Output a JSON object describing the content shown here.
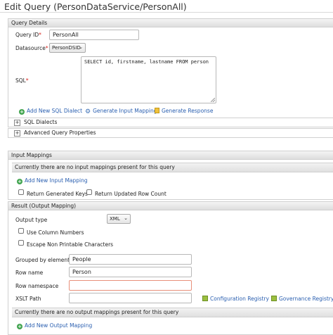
{
  "page": {
    "title": "Edit Query (PersonDataService/PersonAll)"
  },
  "query_details": {
    "header": "Query Details",
    "query_id_label": "Query ID",
    "required_mark": "*",
    "query_id_value": "PersonAll",
    "datasource_label": "Datasource",
    "datasource_value": "PersonDSID",
    "sql_label": "SQL",
    "sql_value": "SELECT id, firstname, lastname FROM person",
    "add_sql_dialect": "Add New SQL Dialect",
    "generate_input": "Generate Input Mappings",
    "generate_response": "Generate Response",
    "sql_dialects": "SQL Dialects",
    "advanced_props": "Advanced Query Properties",
    "expander_symbol": "+"
  },
  "input_mappings": {
    "header": "Input Mappings",
    "empty_message": "Currently there are no input mappings present for this query",
    "add_link": "Add New Input Mapping",
    "return_generated_keys": "Return Generated Keys",
    "return_updated_row_count": "Return Updated Row Count"
  },
  "result": {
    "header": "Result (Output Mapping)",
    "output_type_label": "Output type",
    "output_type_value": "XML",
    "use_column_numbers": "Use Column Numbers",
    "escape_non_printable": "Escape Non Printable Characters",
    "grouped_by_label": "Grouped by element",
    "grouped_by_value": "People",
    "row_name_label": "Row name",
    "row_name_value": "Person",
    "row_namespace_label": "Row namespace",
    "row_namespace_value": "",
    "xslt_label": "XSLT Path",
    "xslt_value": "",
    "config_registry": "Configuration Registry",
    "gov_registry": "Governance Registry",
    "empty_message": "Currently there are no output mappings present for this query",
    "add_output": "Add New Output Mapping"
  },
  "icons": {
    "add": "plus-circle-icon",
    "generate": "gear-icon",
    "response": "document-icon",
    "registry": "registry-icon",
    "dropdown": "chevron-down-icon"
  },
  "colors": {
    "link": "#2a5fb0",
    "required": "#d9231c",
    "add_icon": "#3fa34d"
  }
}
